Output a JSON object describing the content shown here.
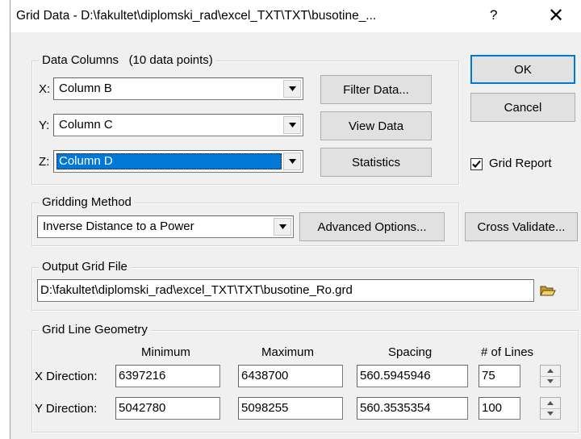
{
  "window": {
    "title": "Grid Data - D:\\fakultet\\diplomski_rad\\excel_TXT\\TXT\\busotine_...",
    "help_glyph": "?",
    "close_glyph": "✕"
  },
  "data_columns": {
    "legend": "Data Columns",
    "points_note": "(10 data points)",
    "x_label": "X:",
    "y_label": "Y:",
    "z_label": "Z:",
    "x_value": "Column B",
    "y_value": "Column C",
    "z_value": "Column D",
    "filter_label": "Filter Data...",
    "view_label": "View Data",
    "stats_label": "Statistics"
  },
  "buttons": {
    "ok": "OK",
    "cancel": "Cancel",
    "cross_validate": "Cross Validate..."
  },
  "grid_report": {
    "label": "Grid Report",
    "checked": true
  },
  "gridding": {
    "legend": "Gridding Method",
    "method": "Inverse Distance to a Power",
    "advanced_label": "Advanced Options..."
  },
  "output": {
    "legend": "Output Grid File",
    "path": "D:\\fakultet\\diplomski_rad\\excel_TXT\\TXT\\busotine_Ro.grd"
  },
  "geometry": {
    "legend": "Grid Line Geometry",
    "headers": {
      "minimum": "Minimum",
      "maximum": "Maximum",
      "spacing": "Spacing",
      "lines": "# of Lines"
    },
    "x": {
      "label": "X Direction:",
      "minimum": "6397216",
      "maximum": "6438700",
      "spacing": "560.5945946",
      "lines": "75"
    },
    "y": {
      "label": "Y Direction:",
      "minimum": "5042780",
      "maximum": "5098255",
      "spacing": "560.3535354",
      "lines": "100"
    }
  },
  "colors": {
    "selection": "#0078d7",
    "dialog_bg": "#f0f0f0",
    "folder": "#e8b84a"
  },
  "icons": {
    "browse": "open-folder-icon",
    "dropdown": "chevron-down-icon"
  }
}
